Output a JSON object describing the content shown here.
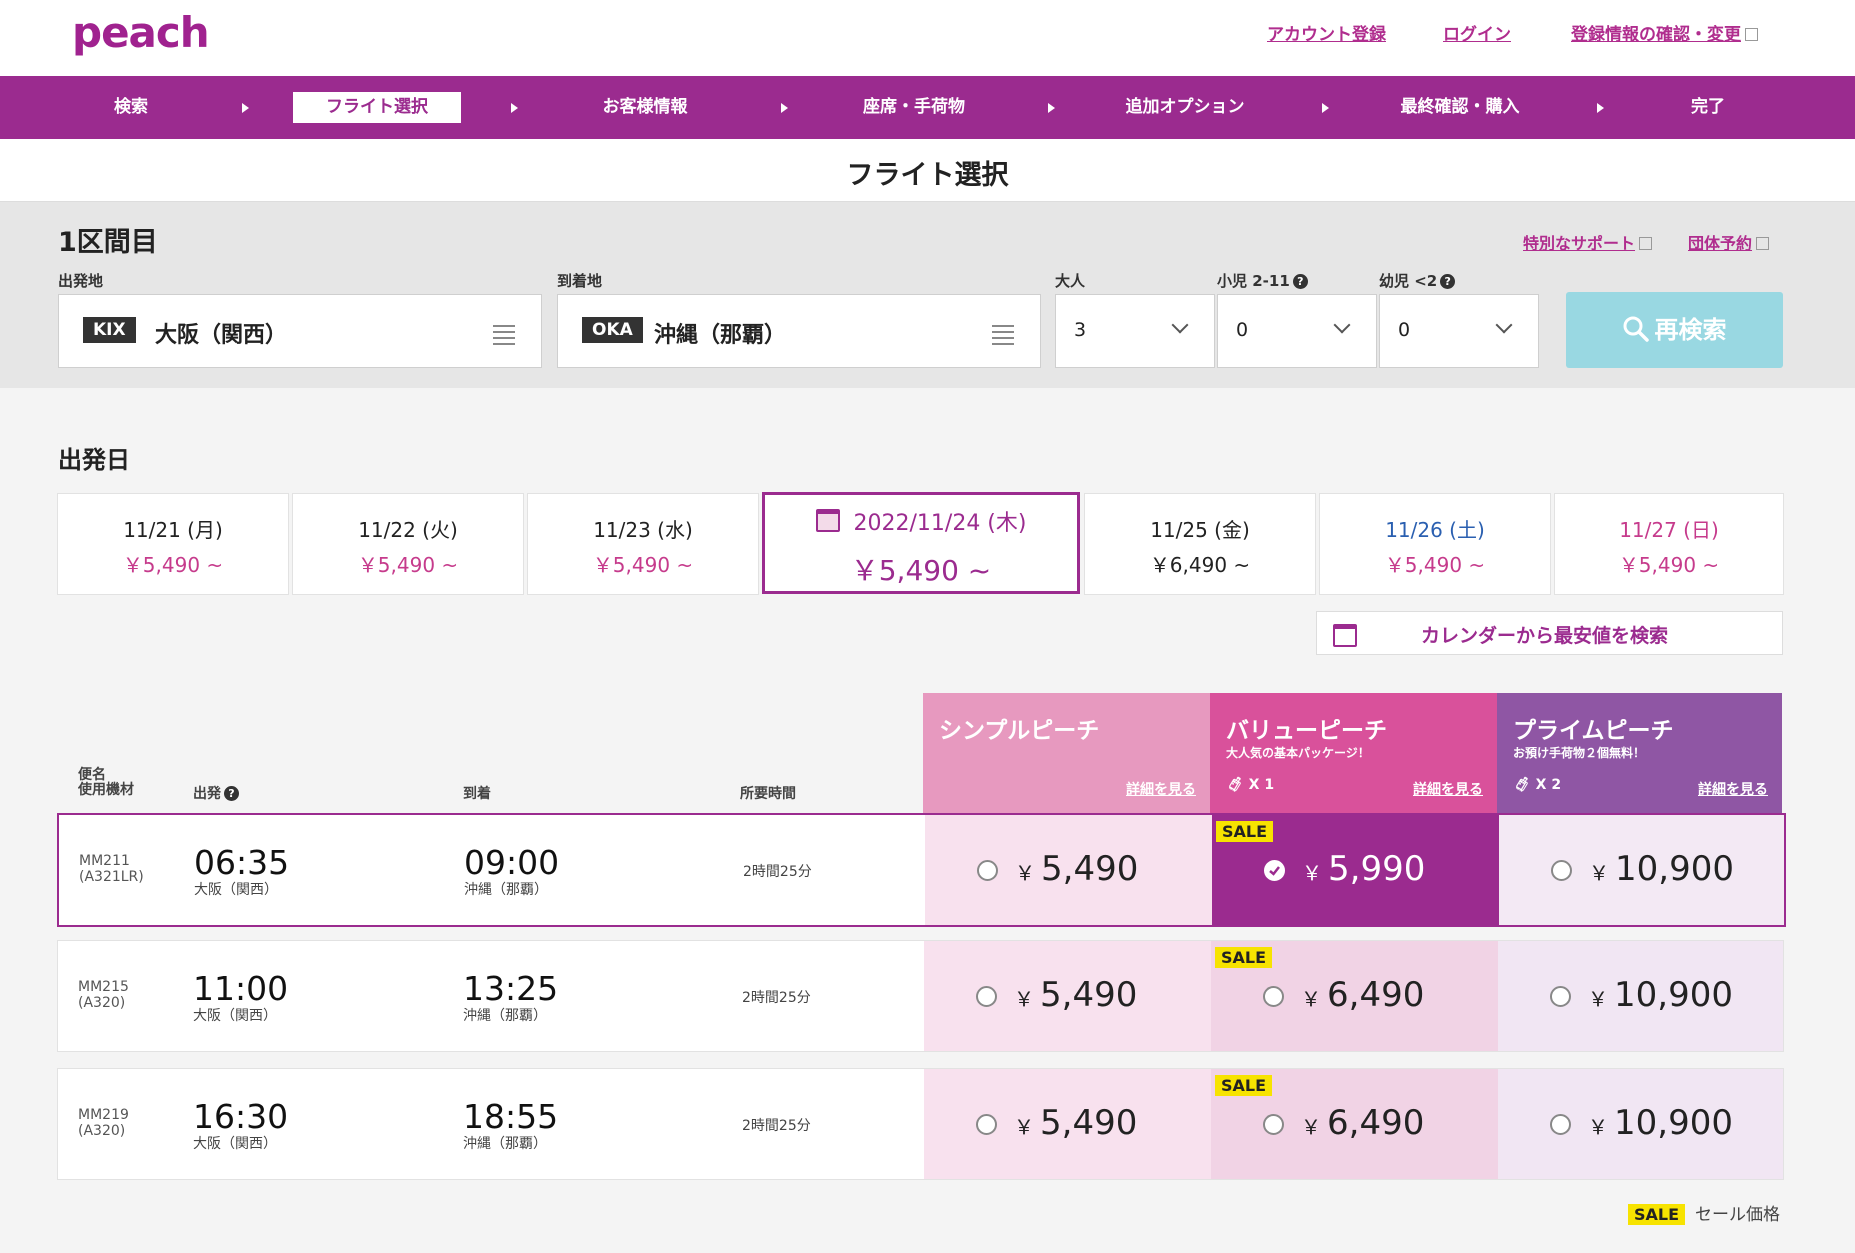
{
  "header": {
    "logo": "peach",
    "links": [
      "アカウント登録",
      "ログイン",
      "登録情報の確認・変更"
    ]
  },
  "nav": {
    "steps": [
      "検索",
      "フライト選択",
      "お客様情報",
      "座席・手荷物",
      "追加オプション",
      "最終確認・購入",
      "完了"
    ],
    "active_index": 1
  },
  "page_title": "フライト選択",
  "search": {
    "segment_title": "1区間目",
    "support_link": "特別なサポート",
    "group_link": "団体予約",
    "origin_label": "出発地",
    "origin_code": "KIX",
    "origin_city": "大阪（関西）",
    "dest_label": "到着地",
    "dest_code": "OKA",
    "dest_city": "沖縄（那覇）",
    "adult_label": "大人",
    "adult_value": "3",
    "child_label": "小児 2-11",
    "child_value": "0",
    "infant_label": "幼児 <2",
    "infant_value": "0",
    "research_label": "再検索"
  },
  "departure": {
    "title": "出発日",
    "dates": [
      {
        "date": "11/21 (月)",
        "price": "￥5,490 ~"
      },
      {
        "date": "11/22 (火)",
        "price": "￥5,490 ~"
      },
      {
        "date": "11/23 (水)",
        "price": "￥5,490 ~"
      },
      {
        "date": "2022/11/24 (木)",
        "price": "￥5,490 ~"
      },
      {
        "date": "11/25 (金)",
        "price": "￥6,490 ~"
      },
      {
        "date": "11/26 (土)",
        "price": "￥5,490 ~"
      },
      {
        "date": "11/27 (日)",
        "price": "￥5,490 ~"
      }
    ],
    "calendar_button": "カレンダーから最安値を検索"
  },
  "fares": {
    "columns": {
      "flight": "便名\n使用機材",
      "dep": "出発",
      "arr": "到着",
      "duration": "所要時間"
    },
    "types": [
      {
        "name": "シンプルピーチ",
        "sub": "",
        "bag": "",
        "detail": "詳細を見る",
        "color": "#e799bf"
      },
      {
        "name": "バリューピーチ",
        "sub": "大人気の基本パッケージ！",
        "bag": "X 1",
        "detail": "詳細を見る",
        "color": "#d9519b"
      },
      {
        "name": "プライムピーチ",
        "sub": "お預け手荷物２個無料！",
        "bag": "X 2",
        "detail": "詳細を見る",
        "color": "#8f56a4"
      }
    ],
    "flights": [
      {
        "no": "MM211",
        "aircraft": "(A321LR)",
        "dep": "06:35",
        "dep_ap": "大阪（関西）",
        "arr": "09:00",
        "arr_ap": "沖縄（那覇）",
        "duration": "2時間25分",
        "prices": [
          "5,490",
          "5,990",
          "10,900"
        ],
        "sale": [
          false,
          true,
          false
        ]
      },
      {
        "no": "MM215",
        "aircraft": "(A320)",
        "dep": "11:00",
        "dep_ap": "大阪（関西）",
        "arr": "13:25",
        "arr_ap": "沖縄（那覇）",
        "duration": "2時間25分",
        "prices": [
          "5,490",
          "6,490",
          "10,900"
        ],
        "sale": [
          false,
          true,
          false
        ]
      },
      {
        "no": "MM219",
        "aircraft": "(A320)",
        "dep": "16:30",
        "dep_ap": "大阪（関西）",
        "arr": "18:55",
        "arr_ap": "沖縄（那覇）",
        "duration": "2時間25分",
        "prices": [
          "5,490",
          "6,490",
          "10,900"
        ],
        "sale": [
          false,
          true,
          false
        ]
      }
    ],
    "selected_flight": 0,
    "selected_fare": 1,
    "yen": "￥",
    "sale_badge": "SALE",
    "legend_text": "セール価格"
  },
  "colors": {
    "brand": "#9b2b8f",
    "sale": "#f7e300"
  }
}
